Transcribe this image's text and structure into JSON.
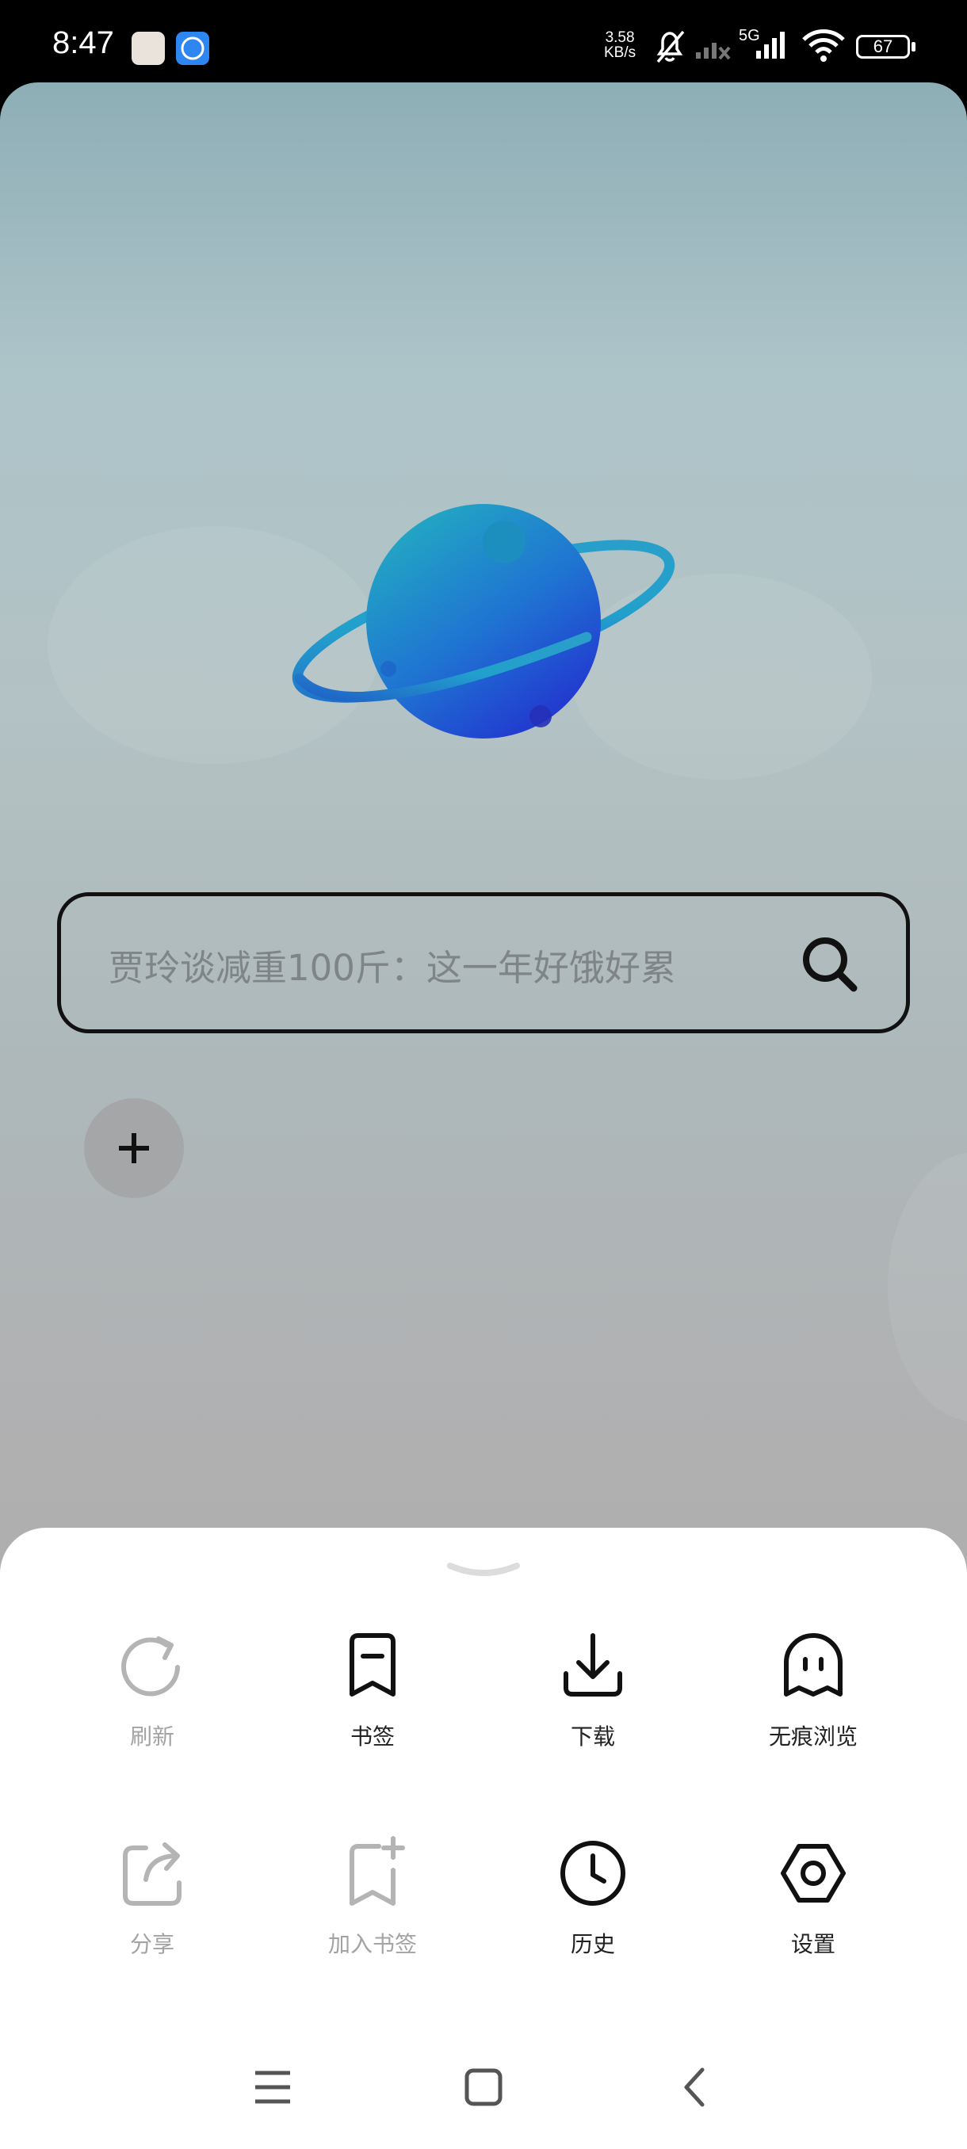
{
  "status_bar": {
    "time": "8:47",
    "net_speed_value": "3.58",
    "net_speed_unit": "KB/s",
    "network_type": "5G",
    "battery": "67"
  },
  "search": {
    "placeholder": "贾玲谈减重100斤：这一年好饿好累"
  },
  "menu": {
    "row1": [
      {
        "label": "刷新",
        "icon": "refresh-icon",
        "enabled": false
      },
      {
        "label": "书签",
        "icon": "bookmark-icon",
        "enabled": true
      },
      {
        "label": "下载",
        "icon": "download-icon",
        "enabled": true
      },
      {
        "label": "无痕浏览",
        "icon": "ghost-icon",
        "enabled": true
      }
    ],
    "row2": [
      {
        "label": "分享",
        "icon": "share-icon",
        "enabled": false
      },
      {
        "label": "加入书签",
        "icon": "add-bookmark-icon",
        "enabled": false
      },
      {
        "label": "历史",
        "icon": "clock-icon",
        "enabled": true
      },
      {
        "label": "设置",
        "icon": "settings-icon",
        "enabled": true
      }
    ]
  },
  "colors": {
    "planet": "#1f5fd2",
    "ring": "#2a9fc9",
    "disabled": "#a3a3a3",
    "icon": "#111111"
  }
}
